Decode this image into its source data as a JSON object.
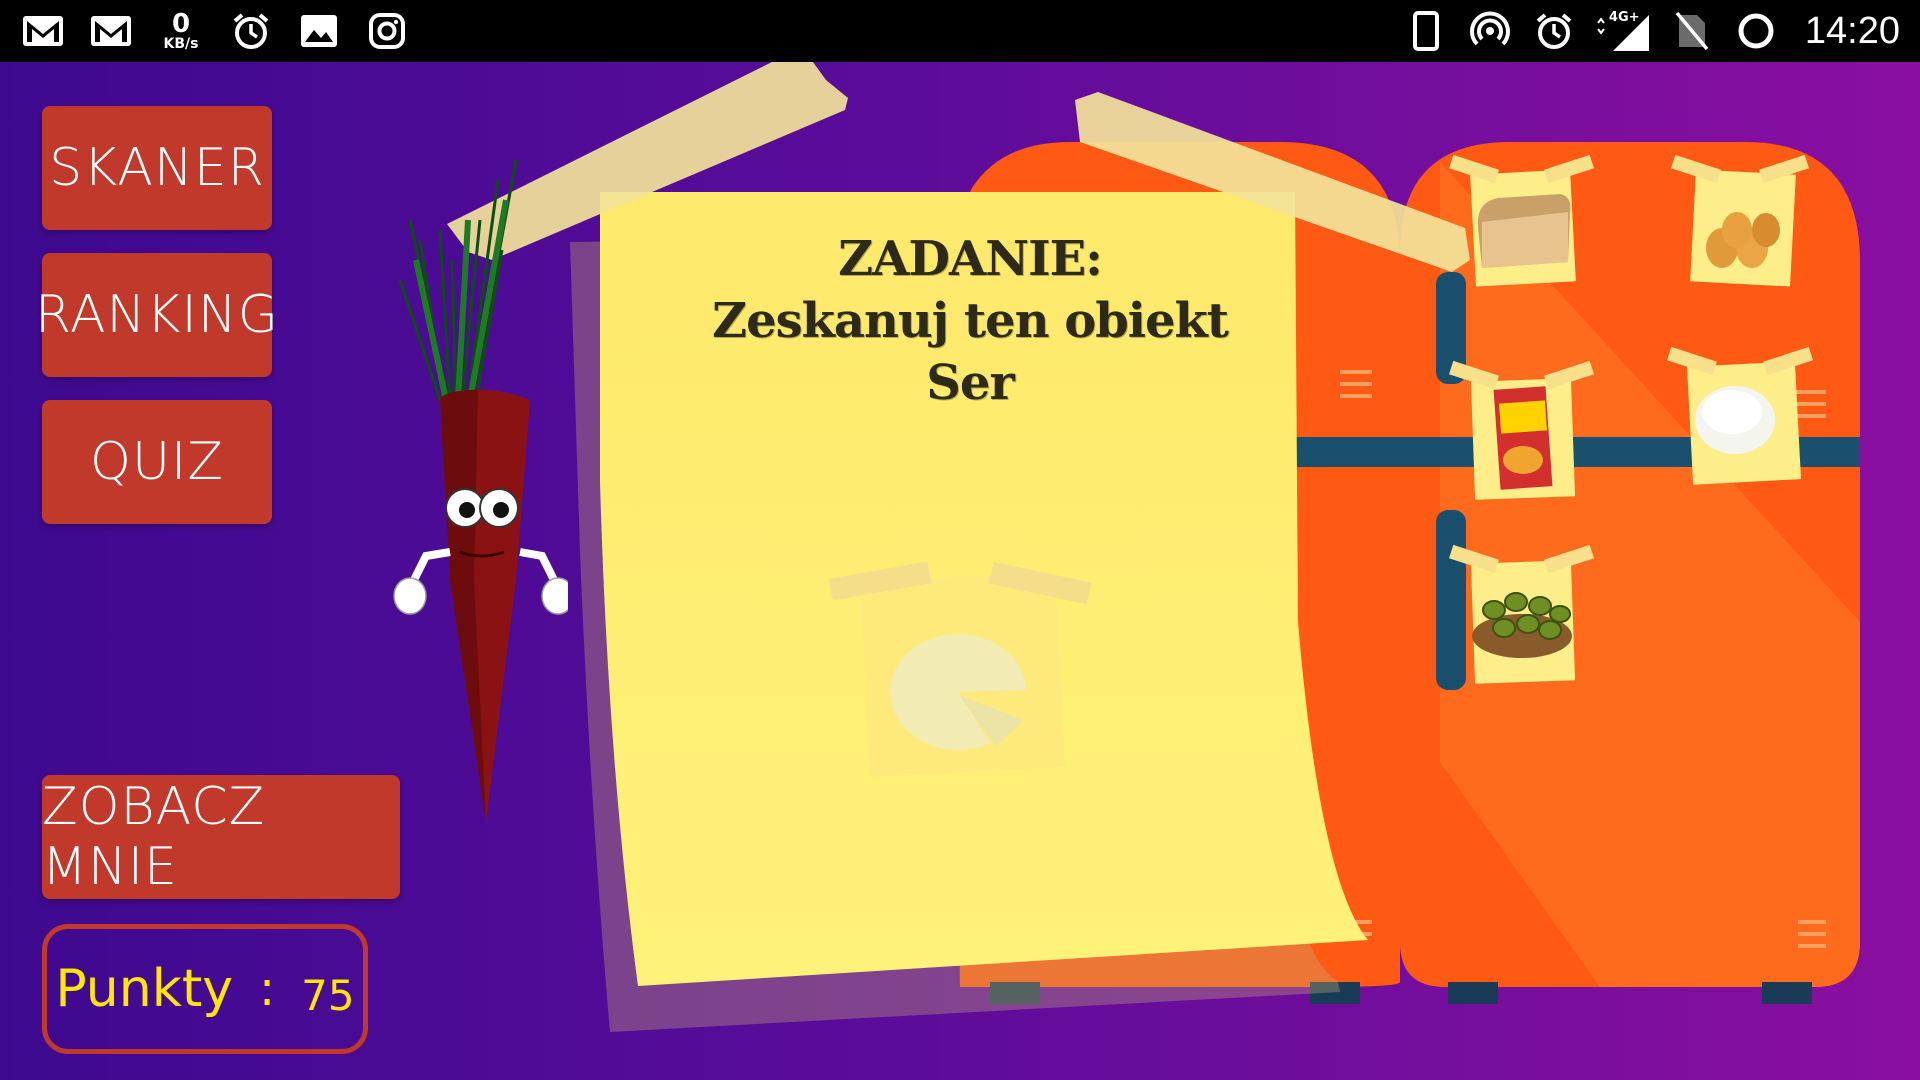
{
  "status_bar": {
    "left_icons": [
      "gmail-icon",
      "gmail-icon",
      "netspeed",
      "alarm-icon",
      "image-icon",
      "instagram-icon"
    ],
    "net_speed_value": "0",
    "net_speed_unit": "KB/s",
    "right_icons": [
      "phone-icon",
      "hotspot-icon",
      "alarm-icon",
      "signal-4g-icon",
      "no-sim-icon",
      "circle-icon"
    ],
    "network_type": "4G+",
    "time": "14:20"
  },
  "menu": {
    "skaner": "SKANER",
    "ranking": "RANKING",
    "quiz": "QUIZ",
    "zobacz_mnie": "ZOBACZ MNIE"
  },
  "score": {
    "label": "Punkty",
    "separator": ":",
    "value": "75"
  },
  "task": {
    "heading": "ZADANIE:",
    "instruction": "Zeskanuj ten obiekt",
    "target": "Ser",
    "target_image": "cheese-image"
  },
  "fridge_items": [
    "bread-image",
    "eggs-image",
    "corn-flakes-image",
    "rice-image",
    "olives-image"
  ],
  "colors": {
    "button": "#c0392b",
    "score_text": "#ffe700",
    "fridge": "#ff5a14",
    "note": "#fff27a"
  }
}
